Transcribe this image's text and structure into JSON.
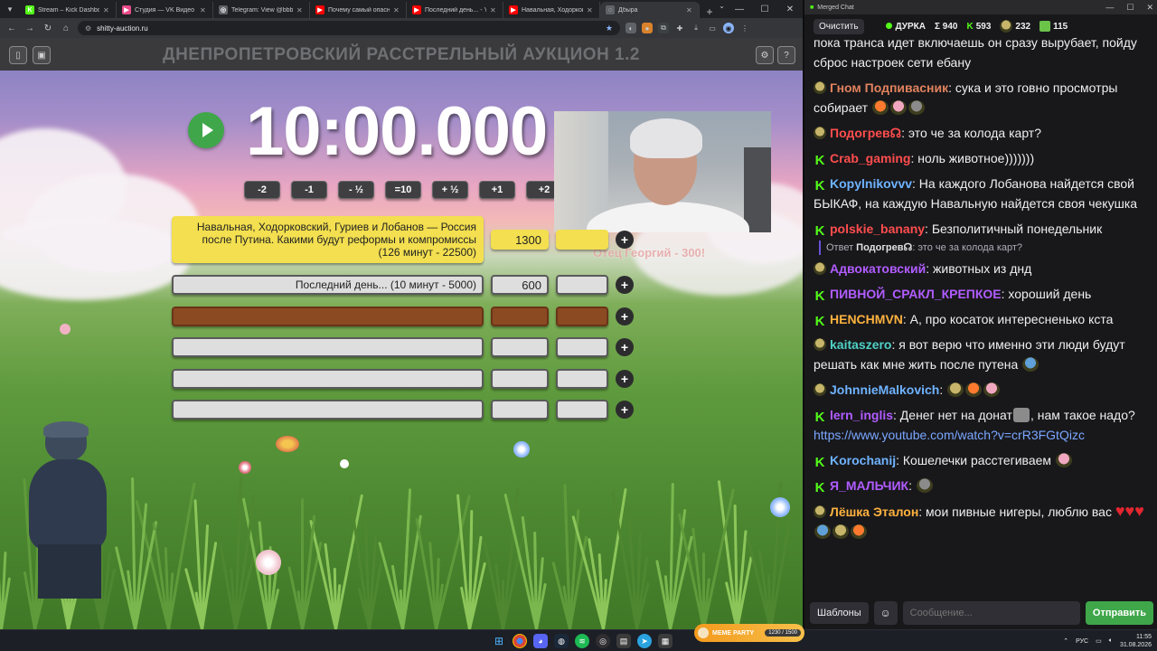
{
  "browser": {
    "tabs": [
      {
        "title": "Stream – Kick Dashboard",
        "fav_color": "#53fc18",
        "fav": "K"
      },
      {
        "title": "Студия — VK Видео Live",
        "fav_color": "#e84a8a",
        "fav": "▶"
      },
      {
        "title": "Telegram: View @bbbreaki",
        "fav_color": "#5f6368",
        "fav": "◎"
      },
      {
        "title": "Почему самый опасный м",
        "fav_color": "#ff0000",
        "fav": "▶"
      },
      {
        "title": "Последний день... - YouTu",
        "fav_color": "#ff0000",
        "fav": "▶"
      },
      {
        "title": "Навальная, Ходорковский,",
        "fav_color": "#ff0000",
        "fav": "▶"
      },
      {
        "title": "Дбыра",
        "fav_color": "#5f6368",
        "fav": "◌"
      }
    ],
    "url": "shitty-auction.ru"
  },
  "app": {
    "title": "ДНЕПРОПЕТРОВСКИЙ РАССТРЕЛЬНЫЙ АУКЦИОН 1.2",
    "timer": "10:00.000",
    "time_buttons": [
      "-2",
      "-1",
      "- ½",
      "=10",
      "+ ½",
      "+1",
      "+2"
    ],
    "bonus_text": "Отец Георгий - 300!",
    "lots": [
      {
        "name": "Навальная, Ходорковский, Гуриев и Лобанов — Россия после Путина. Какими будут реформы и компромиссы (126 минут - 22500)",
        "value": "1300",
        "style": "lead"
      },
      {
        "name": "Последний день... (10 минут - 5000)",
        "value": "600",
        "style": "normal"
      },
      {
        "name": "",
        "value": "",
        "style": "brown"
      },
      {
        "name": "",
        "value": "",
        "style": "normal"
      },
      {
        "name": "",
        "value": "",
        "style": "normal"
      },
      {
        "name": "",
        "value": "",
        "style": "normal"
      }
    ]
  },
  "chat": {
    "window_title": "Merged Chat",
    "clear_label": "Очистить",
    "channel": "ДУРКА",
    "total": "Σ 940",
    "kick_count": "593",
    "frog_count": "232",
    "vk_count": "115",
    "messages": [
      {
        "badge": "",
        "user": "",
        "color": "#efeff1",
        "text": "пока транса идет включаешь он сразу вырубает, пойду сброс настроек сети ебану",
        "cut": true
      },
      {
        "badge": "frog",
        "user": "Гном Подпивасник",
        "color": "#e0825d",
        "text": ": сука и это говно просмотры собирает ",
        "emotes": 3
      },
      {
        "badge": "frog",
        "user": "Подогрев☊",
        "color": "#ff4d4d",
        "text": ": это че за колода карт?"
      },
      {
        "badge": "k",
        "user": "Crab_gaming",
        "color": "#ff4d4d",
        "text": ": ноль животное)))))))"
      },
      {
        "badge": "k",
        "user": "Kopylnikovvv",
        "color": "#6fb3ff",
        "text": ": На каждого Лобанова найдется свой БЫКАФ, на каждую Навальную найдется своя чекушка"
      },
      {
        "badge": "k",
        "user": "polskie_banany",
        "color": "#ff4d4d",
        "text": ": Безполитичный понедельник",
        "reply_user": "Подогрев☊",
        "reply_text": ": это че за колода карт?"
      },
      {
        "badge": "frog",
        "user": "Адвокатовский",
        "color": "#b15cff",
        "text": ": животных из днд"
      },
      {
        "badge": "k",
        "user": "ПИВНОЙ_СРАКЛ_КРЕПКОЕ",
        "color": "#b15cff",
        "text": ": хороший день"
      },
      {
        "badge": "k",
        "user": "HENCHMVN",
        "color": "#ffb23e",
        "text": ": А, про косаток интересненько кста"
      },
      {
        "badge": "frog",
        "user": "kaitaszero",
        "color": "#4fd1c5",
        "text": ": я вот верю что именно эти люди будут решать как мне жить после путена ",
        "emotes": 1
      },
      {
        "badge": "frog",
        "user": "JohnnieMalkovich",
        "color": "#6fb3ff",
        "text": ": ",
        "emotes": 3
      },
      {
        "badge": "k",
        "user": "lern_inglis",
        "color": "#b15cff",
        "text": ": Денег нет на донат",
        "text2": ", нам такое надо? ",
        "link": "https://www.youtube.com/watch?v=crR3FGtQizc"
      },
      {
        "badge": "k",
        "user": "Korochanij",
        "color": "#6fb3ff",
        "text": ": Кошелечки расстегиваем ",
        "emotes": 1
      },
      {
        "badge": "k",
        "user": "Я_МАЛЬЧИК",
        "color": "#b15cff",
        "text": ": ",
        "emotes": 1
      },
      {
        "badge": "frog",
        "user": "Лёшка Эталон",
        "color": "#ffb23e",
        "text": ": мои пивные нигеры, люблю вас ",
        "hearts": 3,
        "emotes": 3
      }
    ],
    "input_placeholder": "Сообщение...",
    "templates_label": "Шаблоны",
    "send_label": "Отправить"
  },
  "taskbar": {
    "meme_label": "MEME PARTY",
    "meme_count": "1230 / 1500",
    "lang": "РУС",
    "time": "11:55",
    "date": "31.08.2026"
  }
}
